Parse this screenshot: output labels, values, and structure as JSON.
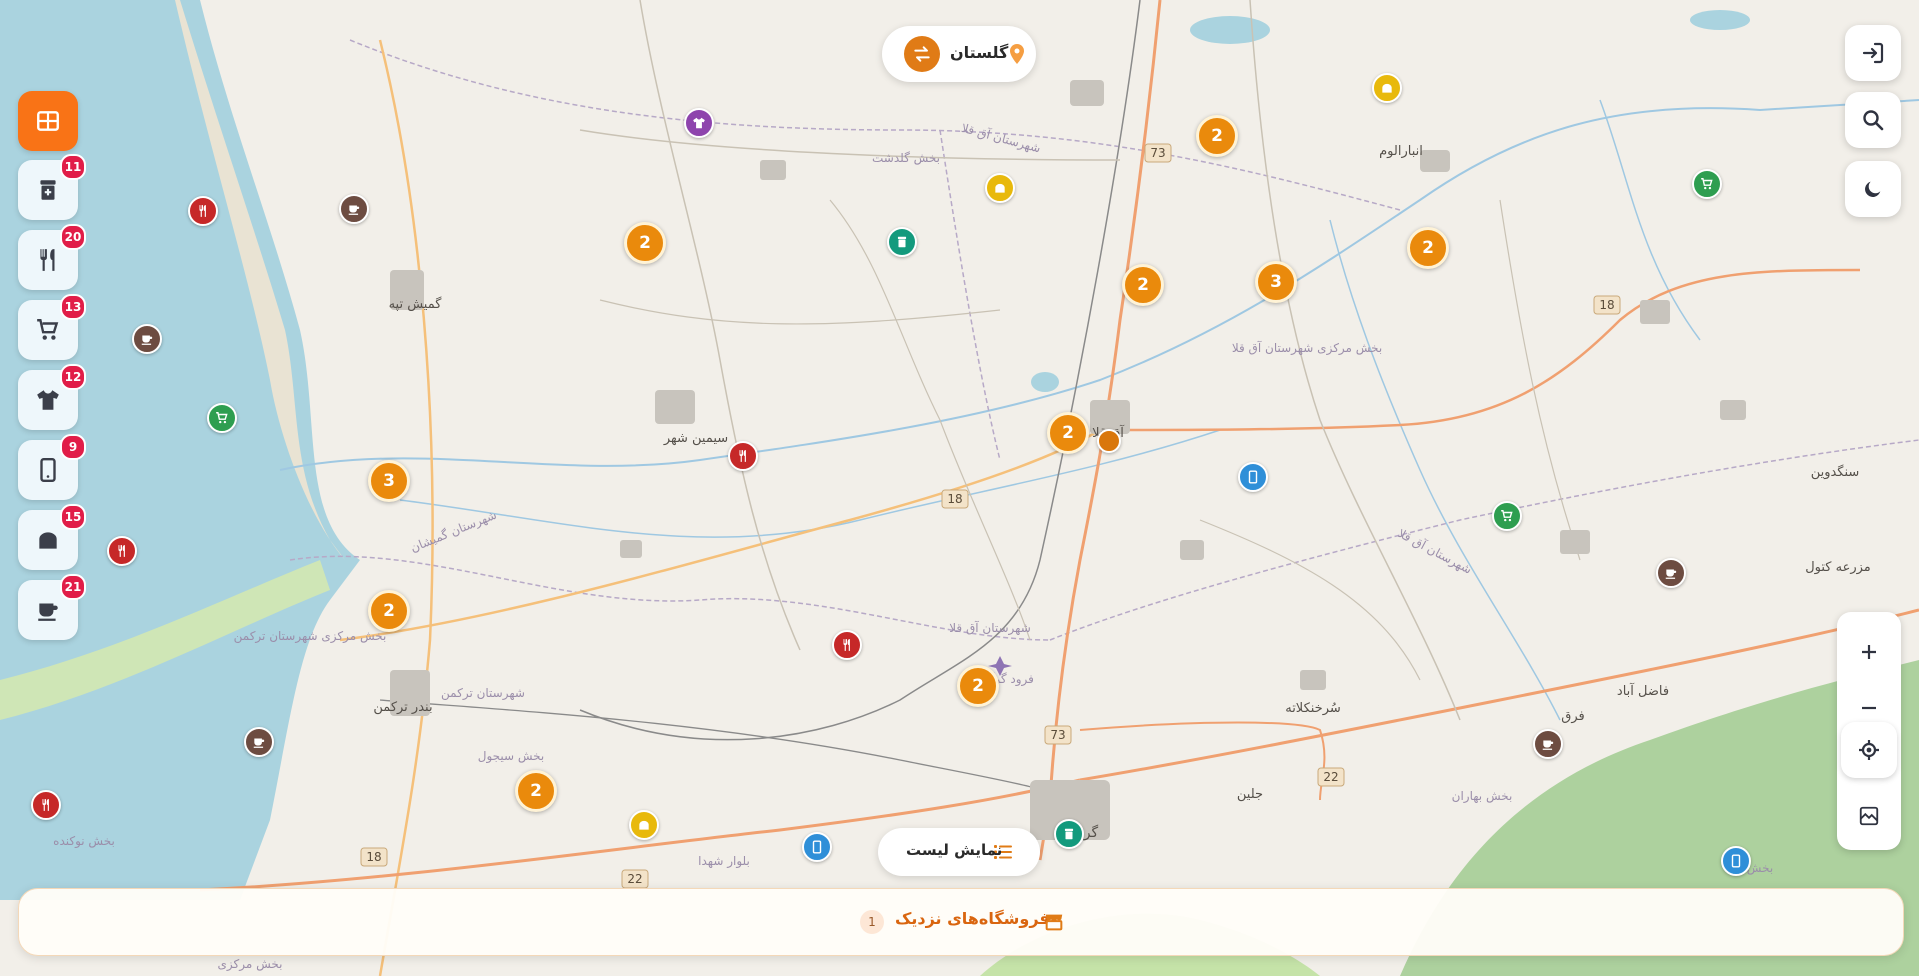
{
  "region_selector": {
    "label": "گلستان"
  },
  "list_button": {
    "label": "نمایش لیست"
  },
  "nearby_bar": {
    "label": "فروشگاه‌های نزدیک",
    "count": "1"
  },
  "categories": [
    {
      "name": "category-grid",
      "icon": "grid-icon",
      "active": true,
      "count": ""
    },
    {
      "name": "category-pharmacy",
      "icon": "pharmacy-icon",
      "count": "11"
    },
    {
      "name": "category-restaurant",
      "icon": "restaurant-icon",
      "count": "20"
    },
    {
      "name": "category-supermarket",
      "icon": "cart-icon",
      "count": "13"
    },
    {
      "name": "category-clothing",
      "icon": "shirt-icon",
      "count": "12"
    },
    {
      "name": "category-mobile",
      "icon": "mobile-icon",
      "count": "9"
    },
    {
      "name": "category-bakery",
      "icon": "bread-icon",
      "count": "15"
    },
    {
      "name": "category-cafe",
      "icon": "coffee-icon",
      "count": "21"
    }
  ],
  "map_labels": {
    "gomishan": "گمیش تپه",
    "simin_shahr": "سیمین شهر",
    "aqqala": "آق قلا",
    "anbar_alum": "انبارالوم",
    "bandar_torkaman": "بندر ترکمن",
    "sorkhankalateh": "سُرخنکلاته",
    "jelin": "جلین",
    "gorgan": "گر",
    "fazel_abad": "فاضل آباد",
    "farq": "فرق",
    "sangdovin": "سنگدوین",
    "mazrae_katul": "مزرعه کتول",
    "bakhsh_golidagh": "بخش گلدشت",
    "shahrestan_aqqala_top": "شهرستان آق قلا",
    "bakhsh_markazi_aqqala": "بخش مرکزی شهرستان آق قلا",
    "shahrestan_gomishan": "شهرستان گمیشان",
    "bakhsh_markazi_torkaman": "بخش مرکزی شهرستان ترکمن",
    "shahrestan_torkaman": "شهرستان ترکمن",
    "bakhsh_siahsool": "بخش سیجول",
    "shahrestan_aqqala_mid": "شهرستان آق قلا",
    "forood_gorgan": "فرود گرگان",
    "shahrestan_aqqala_right": "شهرستان آق قلا",
    "bakhsh_baharan": "بخش بهاران",
    "bakhsh_nokandeh": "بخش نوکنده",
    "bolvar_shohada": "بلوار شهدا",
    "bakhsh_markazi_bottom": "بخش مرکزی",
    "bakhsh_bottom_right": "بخش"
  },
  "road_shields": [
    "73",
    "18",
    "73",
    "22",
    "18",
    "22",
    "18"
  ],
  "clusters": [
    "2",
    "2",
    "2",
    "3",
    "2",
    "3",
    "2",
    "2",
    "2",
    "2"
  ],
  "pin_colors": {
    "restaurant": "#c62828",
    "cafe": "#6d4c41",
    "supermarket": "#2e9e50",
    "mobile": "#2f8fd8",
    "clothing": "#8e44ad",
    "pharmacy": "#139a7d",
    "bakery": "#e8b90c",
    "accent": "#f07b16"
  }
}
